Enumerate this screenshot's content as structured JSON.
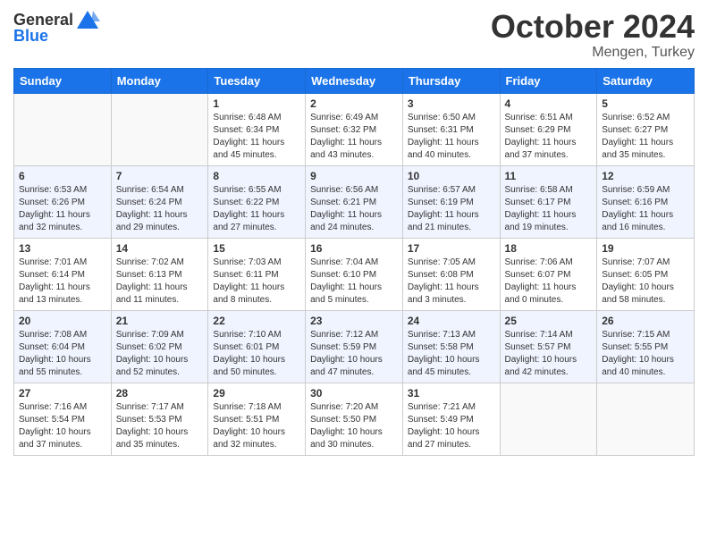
{
  "header": {
    "logo_general": "General",
    "logo_blue": "Blue",
    "month_title": "October 2024",
    "location": "Mengen, Turkey"
  },
  "weekdays": [
    "Sunday",
    "Monday",
    "Tuesday",
    "Wednesday",
    "Thursday",
    "Friday",
    "Saturday"
  ],
  "weeks": [
    [
      {
        "day": "",
        "info": ""
      },
      {
        "day": "",
        "info": ""
      },
      {
        "day": "1",
        "info": "Sunrise: 6:48 AM\nSunset: 6:34 PM\nDaylight: 11 hours and 45 minutes."
      },
      {
        "day": "2",
        "info": "Sunrise: 6:49 AM\nSunset: 6:32 PM\nDaylight: 11 hours and 43 minutes."
      },
      {
        "day": "3",
        "info": "Sunrise: 6:50 AM\nSunset: 6:31 PM\nDaylight: 11 hours and 40 minutes."
      },
      {
        "day": "4",
        "info": "Sunrise: 6:51 AM\nSunset: 6:29 PM\nDaylight: 11 hours and 37 minutes."
      },
      {
        "day": "5",
        "info": "Sunrise: 6:52 AM\nSunset: 6:27 PM\nDaylight: 11 hours and 35 minutes."
      }
    ],
    [
      {
        "day": "6",
        "info": "Sunrise: 6:53 AM\nSunset: 6:26 PM\nDaylight: 11 hours and 32 minutes."
      },
      {
        "day": "7",
        "info": "Sunrise: 6:54 AM\nSunset: 6:24 PM\nDaylight: 11 hours and 29 minutes."
      },
      {
        "day": "8",
        "info": "Sunrise: 6:55 AM\nSunset: 6:22 PM\nDaylight: 11 hours and 27 minutes."
      },
      {
        "day": "9",
        "info": "Sunrise: 6:56 AM\nSunset: 6:21 PM\nDaylight: 11 hours and 24 minutes."
      },
      {
        "day": "10",
        "info": "Sunrise: 6:57 AM\nSunset: 6:19 PM\nDaylight: 11 hours and 21 minutes."
      },
      {
        "day": "11",
        "info": "Sunrise: 6:58 AM\nSunset: 6:17 PM\nDaylight: 11 hours and 19 minutes."
      },
      {
        "day": "12",
        "info": "Sunrise: 6:59 AM\nSunset: 6:16 PM\nDaylight: 11 hours and 16 minutes."
      }
    ],
    [
      {
        "day": "13",
        "info": "Sunrise: 7:01 AM\nSunset: 6:14 PM\nDaylight: 11 hours and 13 minutes."
      },
      {
        "day": "14",
        "info": "Sunrise: 7:02 AM\nSunset: 6:13 PM\nDaylight: 11 hours and 11 minutes."
      },
      {
        "day": "15",
        "info": "Sunrise: 7:03 AM\nSunset: 6:11 PM\nDaylight: 11 hours and 8 minutes."
      },
      {
        "day": "16",
        "info": "Sunrise: 7:04 AM\nSunset: 6:10 PM\nDaylight: 11 hours and 5 minutes."
      },
      {
        "day": "17",
        "info": "Sunrise: 7:05 AM\nSunset: 6:08 PM\nDaylight: 11 hours and 3 minutes."
      },
      {
        "day": "18",
        "info": "Sunrise: 7:06 AM\nSunset: 6:07 PM\nDaylight: 11 hours and 0 minutes."
      },
      {
        "day": "19",
        "info": "Sunrise: 7:07 AM\nSunset: 6:05 PM\nDaylight: 10 hours and 58 minutes."
      }
    ],
    [
      {
        "day": "20",
        "info": "Sunrise: 7:08 AM\nSunset: 6:04 PM\nDaylight: 10 hours and 55 minutes."
      },
      {
        "day": "21",
        "info": "Sunrise: 7:09 AM\nSunset: 6:02 PM\nDaylight: 10 hours and 52 minutes."
      },
      {
        "day": "22",
        "info": "Sunrise: 7:10 AM\nSunset: 6:01 PM\nDaylight: 10 hours and 50 minutes."
      },
      {
        "day": "23",
        "info": "Sunrise: 7:12 AM\nSunset: 5:59 PM\nDaylight: 10 hours and 47 minutes."
      },
      {
        "day": "24",
        "info": "Sunrise: 7:13 AM\nSunset: 5:58 PM\nDaylight: 10 hours and 45 minutes."
      },
      {
        "day": "25",
        "info": "Sunrise: 7:14 AM\nSunset: 5:57 PM\nDaylight: 10 hours and 42 minutes."
      },
      {
        "day": "26",
        "info": "Sunrise: 7:15 AM\nSunset: 5:55 PM\nDaylight: 10 hours and 40 minutes."
      }
    ],
    [
      {
        "day": "27",
        "info": "Sunrise: 7:16 AM\nSunset: 5:54 PM\nDaylight: 10 hours and 37 minutes."
      },
      {
        "day": "28",
        "info": "Sunrise: 7:17 AM\nSunset: 5:53 PM\nDaylight: 10 hours and 35 minutes."
      },
      {
        "day": "29",
        "info": "Sunrise: 7:18 AM\nSunset: 5:51 PM\nDaylight: 10 hours and 32 minutes."
      },
      {
        "day": "30",
        "info": "Sunrise: 7:20 AM\nSunset: 5:50 PM\nDaylight: 10 hours and 30 minutes."
      },
      {
        "day": "31",
        "info": "Sunrise: 7:21 AM\nSunset: 5:49 PM\nDaylight: 10 hours and 27 minutes."
      },
      {
        "day": "",
        "info": ""
      },
      {
        "day": "",
        "info": ""
      }
    ]
  ]
}
